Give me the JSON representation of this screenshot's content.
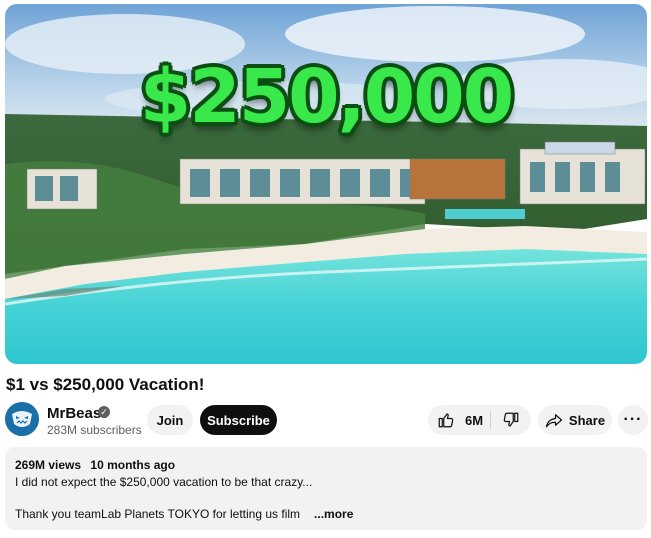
{
  "thumbnail": {
    "headline": "$250,000"
  },
  "video": {
    "title": "$1 vs $250,000 Vacation!"
  },
  "channel": {
    "name": "MrBeast",
    "subscribers": "283M subscribers",
    "verified": true
  },
  "actions": {
    "join_label": "Join",
    "subscribe_label": "Subscribe",
    "like_count": "6M",
    "share_label": "Share",
    "more_label": "···"
  },
  "description": {
    "views": "269M views",
    "age": "10 months ago",
    "line1": "I did not expect the $250,000 vacation to be that crazy...",
    "line2": "Thank you teamLab Planets TOKYO for letting us film",
    "more_link": "...more"
  },
  "colors": {
    "headline_fill": "#39e84a",
    "headline_outline": "#0b4f13",
    "subscribe_bg": "#0f0f0f",
    "pill_bg": "#f2f2f2",
    "water": "#3fd3d6"
  },
  "icons": [
    "thumbs-up-icon",
    "thumbs-down-icon",
    "share-icon",
    "verified-check-icon",
    "more-options-icon"
  ]
}
